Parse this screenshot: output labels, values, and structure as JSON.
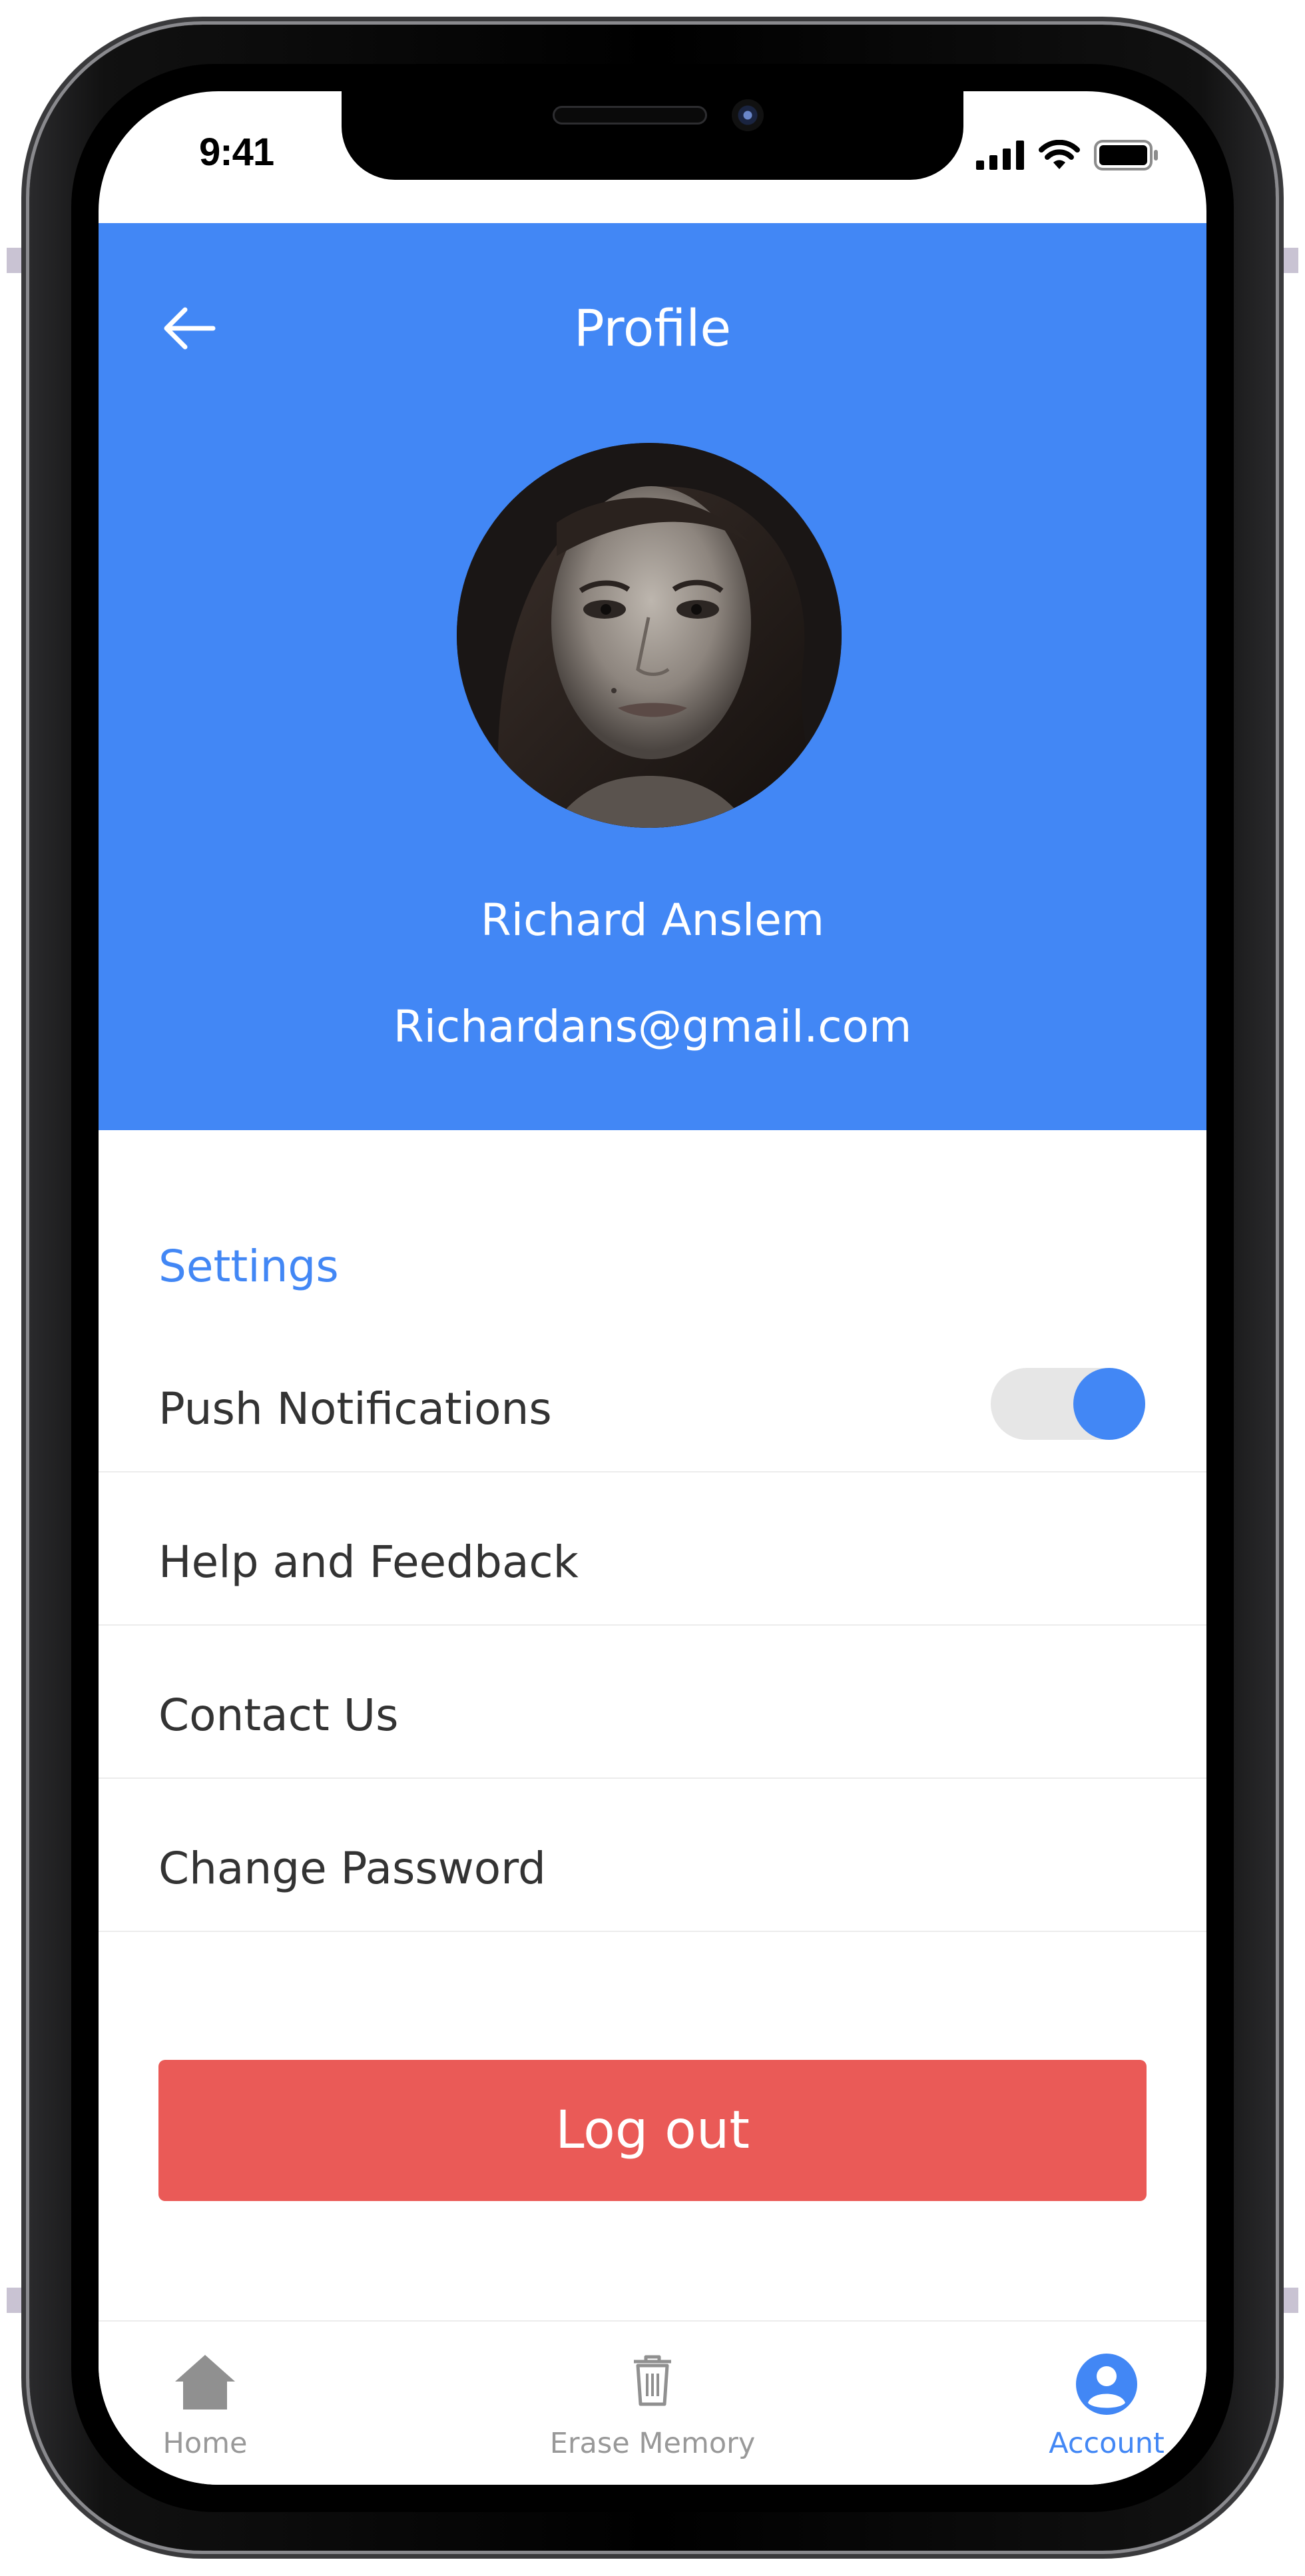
{
  "status_bar": {
    "time": "9:41",
    "icons": [
      "signal-icon",
      "wifi-icon",
      "battery-icon"
    ]
  },
  "header": {
    "title": "Profile",
    "back_icon": "arrow-left-icon",
    "background": "#4287f5"
  },
  "profile": {
    "name": "Richard Anslem",
    "email": "Richardans@gmail.com"
  },
  "settings": {
    "title": "Settings",
    "items": [
      {
        "label": "Push Notifications",
        "toggle": true,
        "enabled": true
      },
      {
        "label": "Help and Feedback"
      },
      {
        "label": "Contact Us"
      },
      {
        "label": "Change Password"
      }
    ]
  },
  "logout": {
    "label": "Log out",
    "color": "#ea5a57"
  },
  "tabbar": {
    "tabs": [
      {
        "label": "Home",
        "icon": "home-icon",
        "active": false
      },
      {
        "label": "Erase Memory",
        "icon": "trash-icon",
        "active": false
      },
      {
        "label": "Account",
        "icon": "account-icon",
        "active": true
      }
    ],
    "active_color": "#4287f5",
    "inactive_color": "#999999"
  }
}
